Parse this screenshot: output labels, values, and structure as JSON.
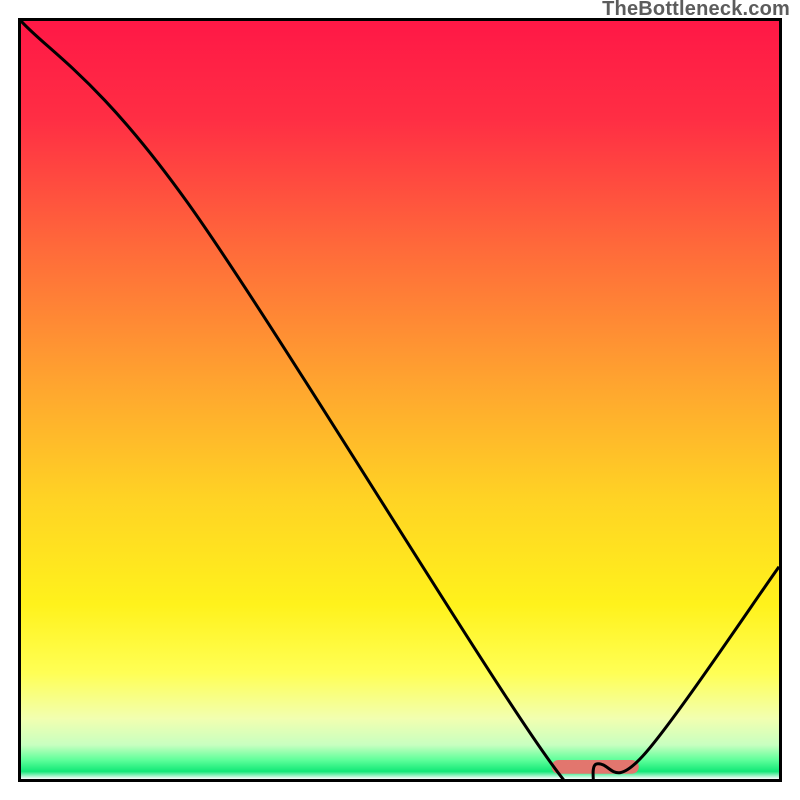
{
  "watermark": {
    "text": "TheBottleneck.com"
  },
  "chart_data": {
    "type": "line",
    "title": "",
    "xlabel": "",
    "ylabel": "",
    "xlim": [
      0,
      100
    ],
    "ylim": [
      0,
      100
    ],
    "grid": false,
    "series": [
      {
        "name": "bottleneck-curve",
        "x": [
          0,
          22,
          70,
          76,
          82,
          100
        ],
        "values": [
          100,
          76,
          2,
          2,
          3,
          28
        ]
      }
    ],
    "gradient_stops": [
      {
        "offset": 0.0,
        "color": "#ff1846"
      },
      {
        "offset": 0.13,
        "color": "#ff2e44"
      },
      {
        "offset": 0.3,
        "color": "#ff6a3a"
      },
      {
        "offset": 0.48,
        "color": "#ffa52f"
      },
      {
        "offset": 0.63,
        "color": "#ffd324"
      },
      {
        "offset": 0.77,
        "color": "#fff21c"
      },
      {
        "offset": 0.86,
        "color": "#ffff55"
      },
      {
        "offset": 0.92,
        "color": "#f2ffb0"
      },
      {
        "offset": 0.955,
        "color": "#c8ffc0"
      },
      {
        "offset": 0.975,
        "color": "#5eff9a"
      },
      {
        "offset": 0.99,
        "color": "#12e877"
      },
      {
        "offset": 1.0,
        "color": "#ffffff"
      }
    ],
    "optimal_marker": {
      "x_start": 70,
      "x_end": 81.5,
      "y": 1.6,
      "color": "#e2766e",
      "thickness_pct": 1.8
    },
    "curve_stroke": {
      "color": "#000000",
      "width": 3
    }
  }
}
